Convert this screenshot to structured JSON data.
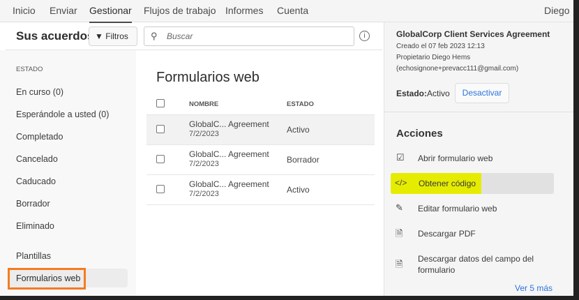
{
  "nav": {
    "items": [
      "Inicio",
      "Enviar",
      "Gestionar",
      "Flujos de trabajo",
      "Informes",
      "Cuenta"
    ],
    "active": "Gestionar",
    "user": "Diego"
  },
  "toolbar": {
    "title": "Sus acuerdos",
    "filters": "Filtros",
    "search_placeholder": "Buscar"
  },
  "sidebar": {
    "section": "ESTADO",
    "items": [
      "En curso (0)",
      "Esperándole a usted (0)",
      "Completado",
      "Cancelado",
      "Caducado",
      "Borrador",
      "Eliminado"
    ],
    "templates": "Plantillas",
    "web_forms": "Formularios web"
  },
  "list": {
    "title": "Formularios web",
    "columns": [
      "NOMBRE",
      "ESTADO"
    ],
    "rows": [
      {
        "name": "GlobalC... Agreement",
        "date": "7/2/2023",
        "status": "Activo"
      },
      {
        "name": "GlobalC... Agreement",
        "date": "7/2/2023",
        "status": "Borrador"
      },
      {
        "name": "GlobalC... Agreement",
        "date": "7/2/2023",
        "status": "Activo"
      }
    ]
  },
  "details": {
    "title": "GlobalCorp Client Services Agreement",
    "created": "Creado el 07 feb 2023 12:13",
    "owner": "Propietario Diego Hems",
    "email": "(echosignone+prevacc111@gmail.com)",
    "status_label": "Estado:",
    "status_value": "Activo",
    "deactivate": "Desactivar"
  },
  "actions": {
    "title": "Acciones",
    "items": [
      "Abrir formulario web",
      "Obtener código",
      "Editar formulario web",
      "Descargar PDF",
      "Descargar datos del campo del formulario"
    ],
    "more": "Ver 5 más"
  },
  "colors": {
    "accent": "#2b73e0",
    "highlight": "#e5ec00",
    "outline": "#f47b20"
  }
}
